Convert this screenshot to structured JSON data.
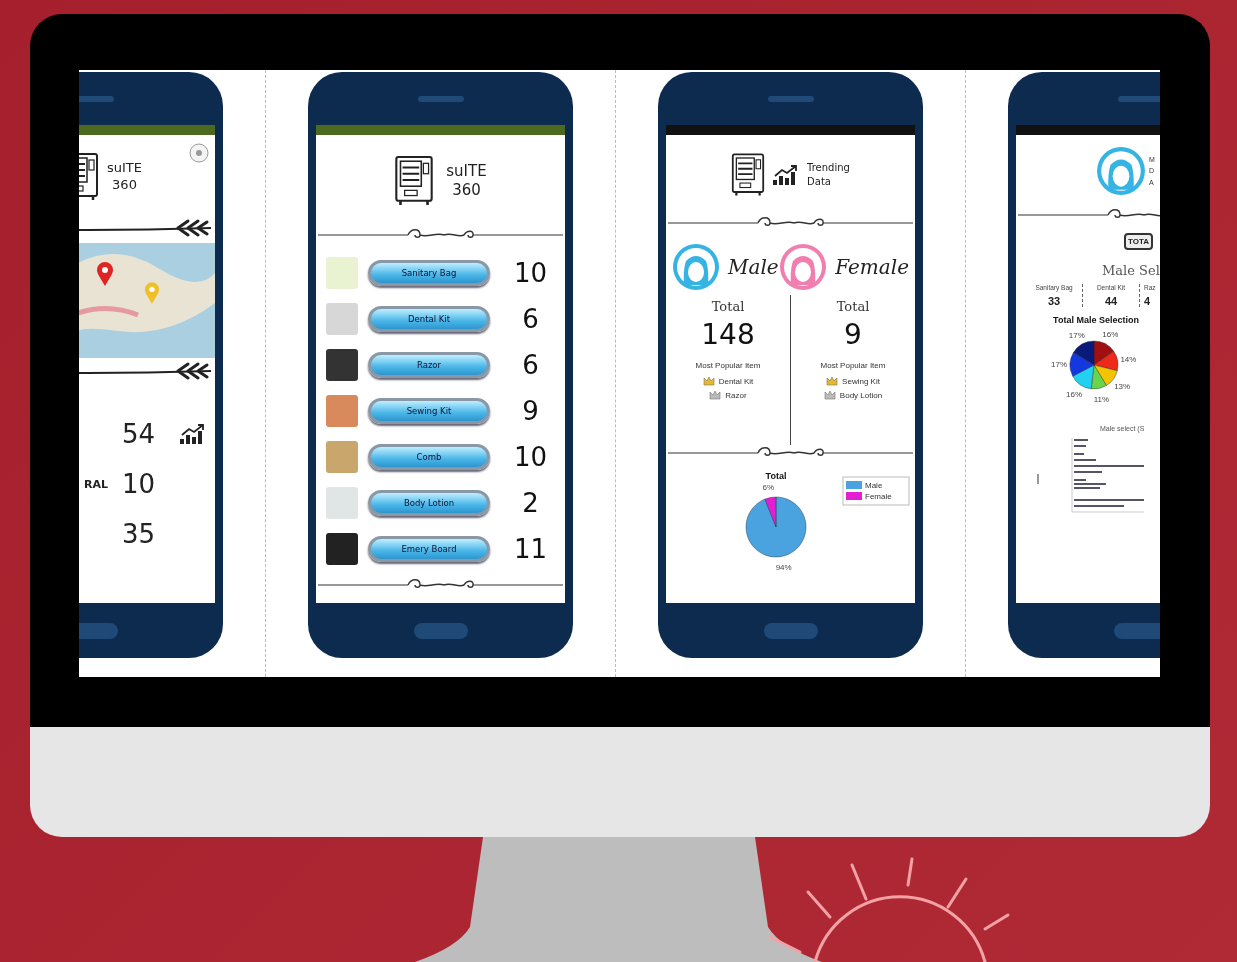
{
  "screens": [
    {
      "kind": "home",
      "brand": [
        "suITE",
        "360"
      ],
      "stats": [
        {
          "value": "54",
          "trend": true
        },
        {
          "label": "RAL",
          "value": "10",
          "trend": false
        },
        {
          "value": "35",
          "trend": false
        }
      ]
    },
    {
      "kind": "inventory",
      "brand": [
        "suITE",
        "360"
      ],
      "items": [
        {
          "name": "Sanitary Bag",
          "count": "10"
        },
        {
          "name": "Dental Kit",
          "count": "6"
        },
        {
          "name": "Razor",
          "count": "6"
        },
        {
          "name": "Sewing Kit",
          "count": "9"
        },
        {
          "name": "Comb",
          "count": "10"
        },
        {
          "name": "Body Lotion",
          "count": "2"
        },
        {
          "name": "Emery Board",
          "count": "11"
        }
      ]
    },
    {
      "kind": "trending",
      "title": [
        "Trending",
        "Data"
      ],
      "groups": [
        {
          "gender": "Male",
          "color": "#35b4e4",
          "total_label": "Total",
          "total": "148",
          "popular_label": "Most Popular Item",
          "items": [
            "Dental Kit",
            "Razor"
          ]
        },
        {
          "gender": "Female",
          "color": "#f07fb0",
          "total_label": "Total",
          "total": "9",
          "popular_label": "Most Popular Item",
          "items": [
            "Sewing Kit",
            "Body Lotion"
          ]
        }
      ],
      "chart_data": {
        "type": "pie",
        "title": "Total",
        "categories": [
          "Male",
          "Female"
        ],
        "values": [
          94,
          6
        ],
        "value_labels": [
          "94%",
          "6%"
        ],
        "legend": "right"
      }
    },
    {
      "kind": "male_detail",
      "header_lines": [
        "M",
        "D",
        "A"
      ],
      "stamp": "TOTA",
      "heading": "Male Sel",
      "selections": [
        {
          "label": "Sanitary Bag",
          "value": "33"
        },
        {
          "label": "Dental Kit",
          "value": "44"
        },
        {
          "label": "Raz",
          "value": "4"
        }
      ],
      "chart_data": {
        "type": "pie",
        "title": "Total Male Selection",
        "values": [
          16,
          14,
          13,
          11,
          16,
          17,
          17
        ],
        "value_labels": [
          "16%",
          "14%",
          "13%",
          "11%",
          "16%",
          "17%",
          "17%"
        ]
      },
      "bar_chart_title": "Male select (S"
    }
  ]
}
